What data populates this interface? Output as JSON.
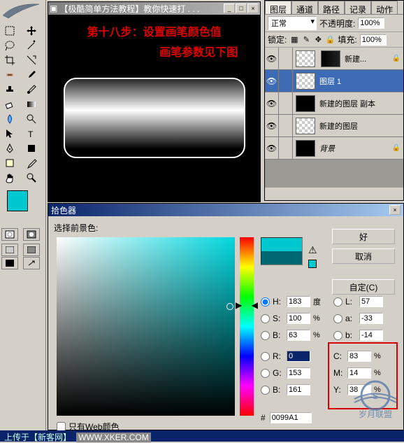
{
  "doc": {
    "title": "【极酷简单方法教程】教你快速打 . . .",
    "step_line1": "第十八步：设置画笔颜色值",
    "step_line2": "画笔参数见下图"
  },
  "layers": {
    "tabs": [
      "图层",
      "通道",
      "路径",
      "记录",
      "动作"
    ],
    "blend_mode": "正常",
    "opacity_label": "不透明度:",
    "opacity_value": "100%",
    "lock_label": "锁定:",
    "fill_label": "填充:",
    "fill_value": "100%",
    "items": [
      {
        "name": "新建...",
        "locked": true
      },
      {
        "name": "图层 1",
        "selected": true
      },
      {
        "name": "新建的图层 副本"
      },
      {
        "name": "新建的图层"
      },
      {
        "name": "背景",
        "locked": true
      }
    ]
  },
  "picker": {
    "title": "拾色器",
    "prompt": "选择前景色:",
    "ok": "好",
    "cancel": "取消",
    "custom": "自定(C)",
    "H": {
      "label": "H:",
      "value": "183",
      "unit": "度"
    },
    "S": {
      "label": "S:",
      "value": "100",
      "unit": "%"
    },
    "B": {
      "label": "B:",
      "value": "63",
      "unit": "%"
    },
    "R": {
      "label": "R:",
      "value": "0"
    },
    "G": {
      "label": "G:",
      "value": "153"
    },
    "Bb": {
      "label": "B:",
      "value": "161"
    },
    "L": {
      "label": "L:",
      "value": "57"
    },
    "a": {
      "label": "a:",
      "value": "-33"
    },
    "b2": {
      "label": "b:",
      "value": "-14"
    },
    "C": {
      "label": "C:",
      "value": "83",
      "unit": "%"
    },
    "M": {
      "label": "M:",
      "value": "14",
      "unit": "%"
    },
    "Y": {
      "label": "Y:",
      "value": "38",
      "unit": "%"
    },
    "hex_label": "#",
    "hex_value": "0099A1",
    "web_only": "只有Web颜色"
  },
  "footer": {
    "text": "上传于【新客网】",
    "url": "WWW.XKER.COM"
  }
}
